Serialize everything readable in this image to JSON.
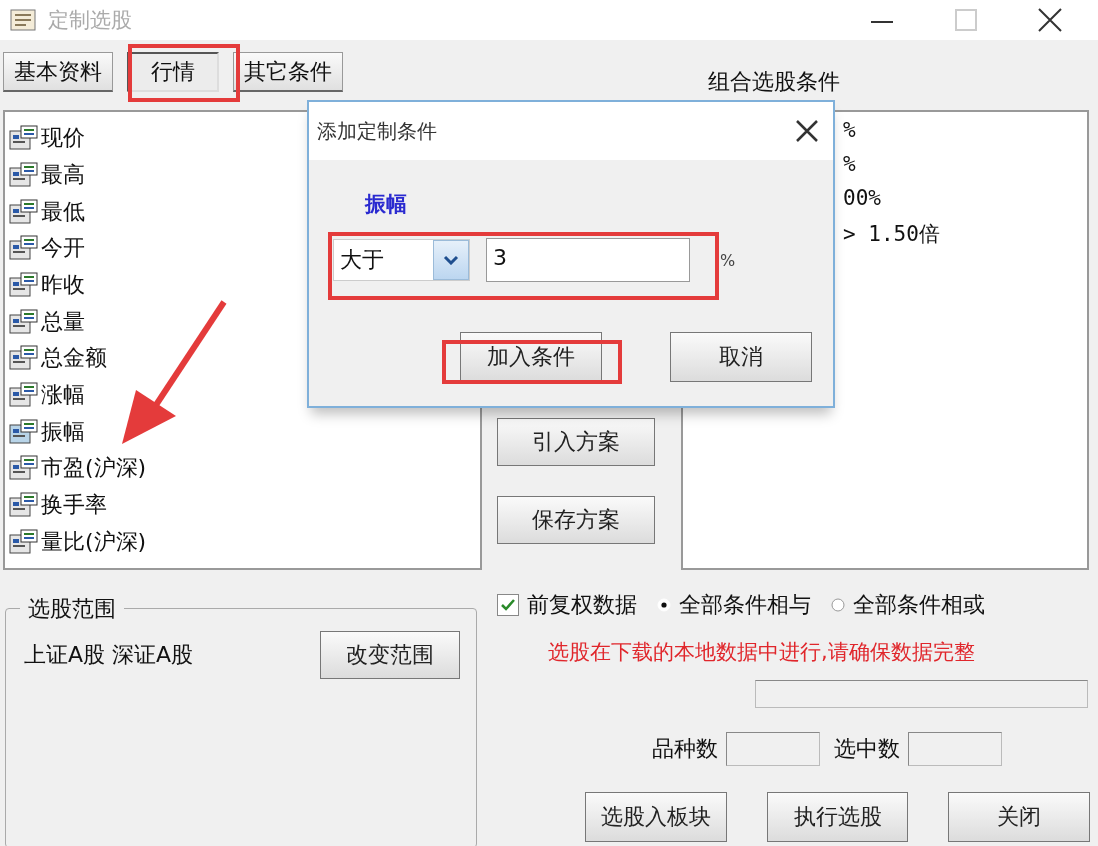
{
  "window": {
    "title": "定制选股"
  },
  "tabs": [
    {
      "label": "基本资料",
      "selected": false
    },
    {
      "label": "行情",
      "selected": true
    },
    {
      "label": "其它条件",
      "selected": false
    }
  ],
  "field_list": [
    "现价",
    "最高",
    "最低",
    "今开",
    "昨收",
    "总量",
    "总金额",
    "涨幅",
    "振幅",
    "市盈(沪深)",
    "换手率",
    "量比(沪深)"
  ],
  "conditions": {
    "title": "组合选股条件",
    "lines": [
      "%",
      "%",
      "00%",
      "> 1.50倍"
    ]
  },
  "scheme_buttons": [
    "引入方案",
    "保存方案"
  ],
  "range": {
    "title": "选股范围",
    "value": "上证A股  深证A股",
    "button": "改变范围"
  },
  "checkbox": {
    "label": "前复权数据",
    "checked": true
  },
  "radios": [
    {
      "label": "全部条件相与",
      "selected": true
    },
    {
      "label": "全部条件相或",
      "selected": false
    }
  ],
  "notice": "选股在下载的本地数据中进行,请确保数据完整",
  "count_labels": [
    "品种数",
    "选中数"
  ],
  "actions": [
    "选股入板块",
    "执行选股",
    "关闭"
  ],
  "dialog": {
    "title": "添加定制条件",
    "field": "振幅",
    "operator": "大于",
    "value": "3",
    "unit": "%",
    "buttons": [
      "加入条件",
      "取消"
    ]
  }
}
